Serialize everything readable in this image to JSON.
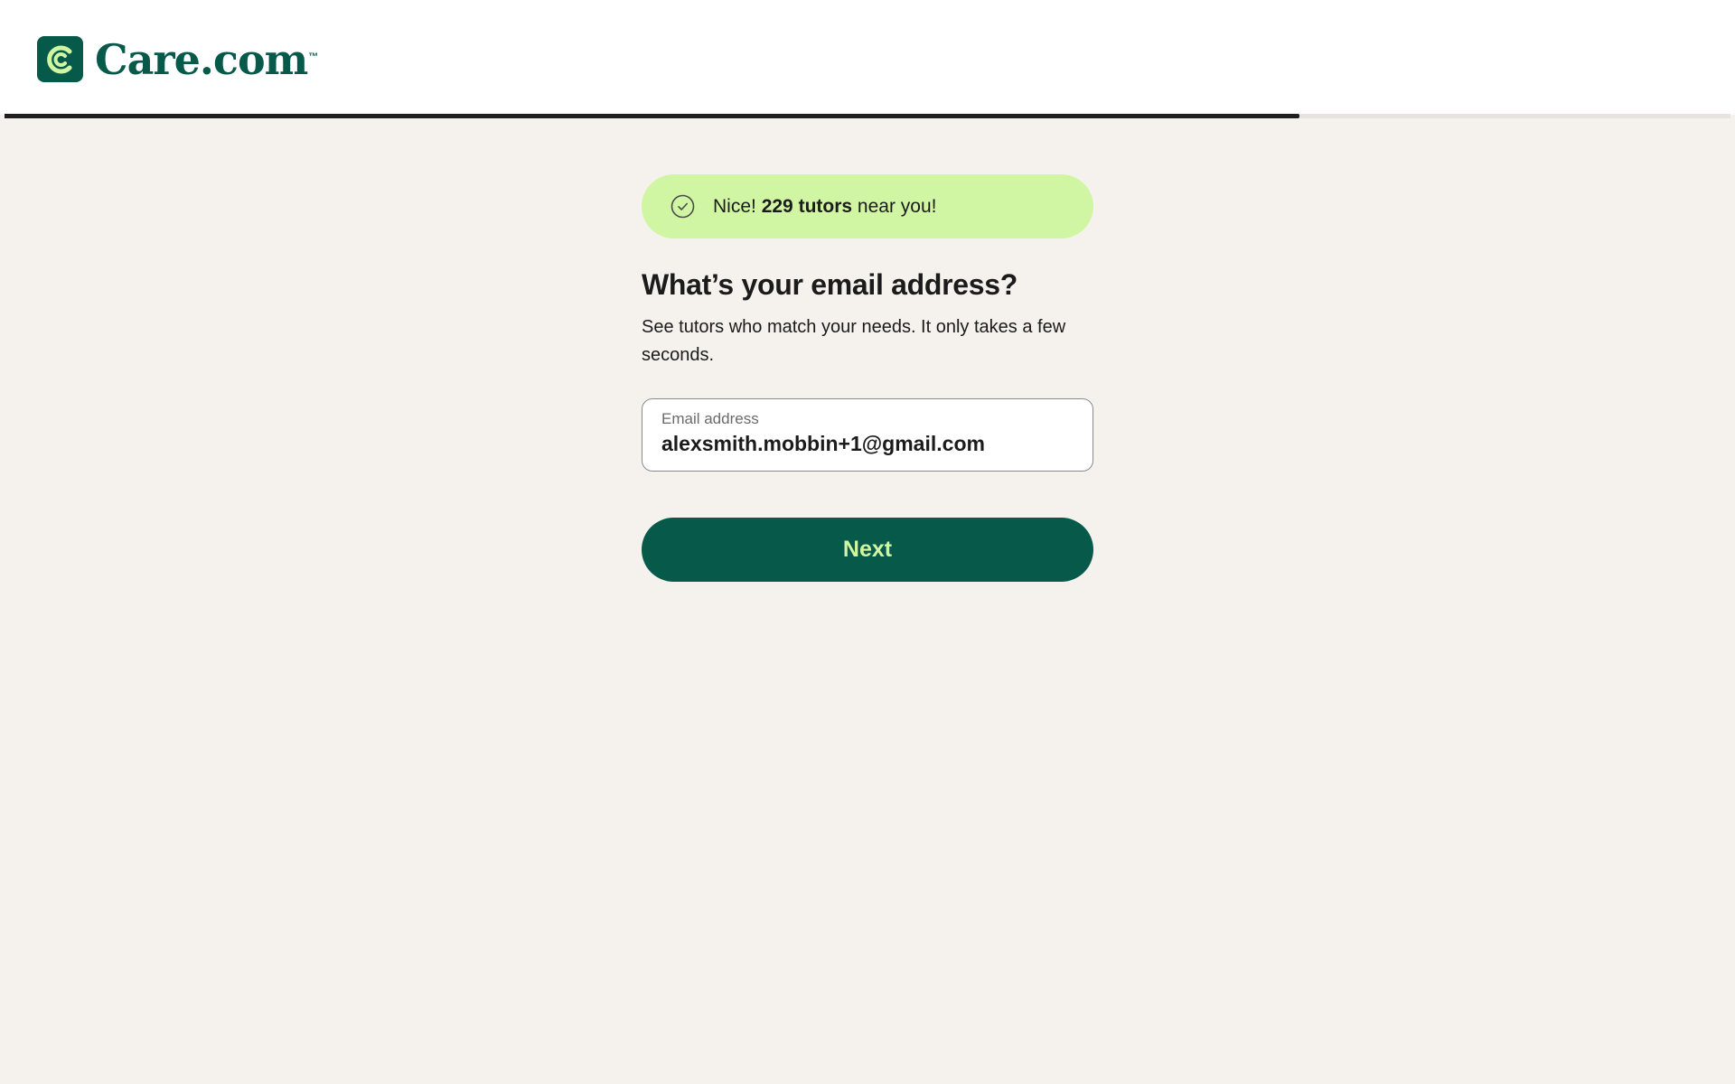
{
  "header": {
    "logo_text": "Care.com",
    "logo_tm": "™",
    "logo_icon": "care-c-logo-icon"
  },
  "progress": {
    "value_percent": 75
  },
  "banner": {
    "icon": "check-circle-icon",
    "prefix": "Nice!",
    "count_text": "229 tutors",
    "suffix": "near you!"
  },
  "form": {
    "title": "What’s your email address?",
    "subtitle": "See tutors who match your needs. It only takes a few seconds.",
    "email_label": "Email address",
    "email_value": "alexsmith.mobbin+1@gmail.com",
    "next_label": "Next"
  },
  "colors": {
    "brand_green": "#075a4a",
    "accent_lime": "#d1f6a3",
    "page_bg": "#f5f2ee"
  }
}
